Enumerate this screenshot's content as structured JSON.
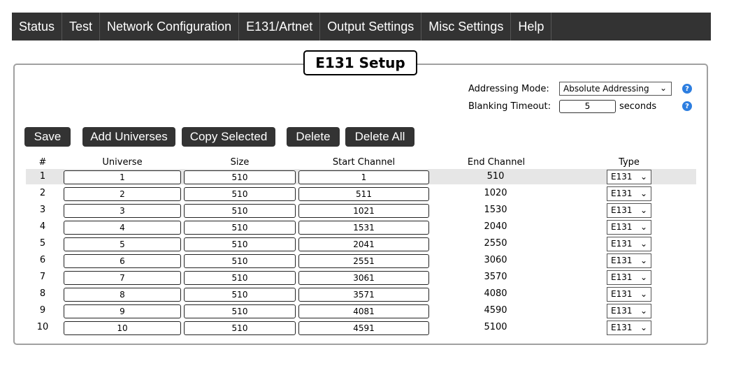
{
  "nav": {
    "items": [
      "Status",
      "Test",
      "Network Configuration",
      "E131/Artnet",
      "Output Settings",
      "Misc Settings",
      "Help"
    ]
  },
  "panel": {
    "title": "E131 Setup",
    "addressing_mode_label": "Addressing Mode:",
    "addressing_mode_value": "Absolute Addressing",
    "blanking_timeout_label": "Blanking Timeout:",
    "blanking_timeout_value": "5",
    "blanking_timeout_unit": "seconds",
    "help_icon": "?"
  },
  "buttons": {
    "save": "Save",
    "add_universes": "Add Universes",
    "copy_selected": "Copy Selected",
    "delete": "Delete",
    "delete_all": "Delete All"
  },
  "table": {
    "headers": [
      "#",
      "Universe",
      "Size",
      "Start Channel",
      "End Channel",
      "Type"
    ],
    "rows": [
      {
        "num": "1",
        "universe": "1",
        "size": "510",
        "start": "1",
        "end": "510",
        "type": "E131"
      },
      {
        "num": "2",
        "universe": "2",
        "size": "510",
        "start": "511",
        "end": "1020",
        "type": "E131"
      },
      {
        "num": "3",
        "universe": "3",
        "size": "510",
        "start": "1021",
        "end": "1530",
        "type": "E131"
      },
      {
        "num": "4",
        "universe": "4",
        "size": "510",
        "start": "1531",
        "end": "2040",
        "type": "E131"
      },
      {
        "num": "5",
        "universe": "5",
        "size": "510",
        "start": "2041",
        "end": "2550",
        "type": "E131"
      },
      {
        "num": "6",
        "universe": "6",
        "size": "510",
        "start": "2551",
        "end": "3060",
        "type": "E131"
      },
      {
        "num": "7",
        "universe": "7",
        "size": "510",
        "start": "3061",
        "end": "3570",
        "type": "E131"
      },
      {
        "num": "8",
        "universe": "8",
        "size": "510",
        "start": "3571",
        "end": "4080",
        "type": "E131"
      },
      {
        "num": "9",
        "universe": "9",
        "size": "510",
        "start": "4081",
        "end": "4590",
        "type": "E131"
      },
      {
        "num": "10",
        "universe": "10",
        "size": "510",
        "start": "4591",
        "end": "5100",
        "type": "E131"
      }
    ],
    "selected_row": 1
  },
  "colors": {
    "navbar": "#333333",
    "button": "#333333",
    "help_icon": "#2d7ee0",
    "selected_row": "#e6e6e6"
  }
}
